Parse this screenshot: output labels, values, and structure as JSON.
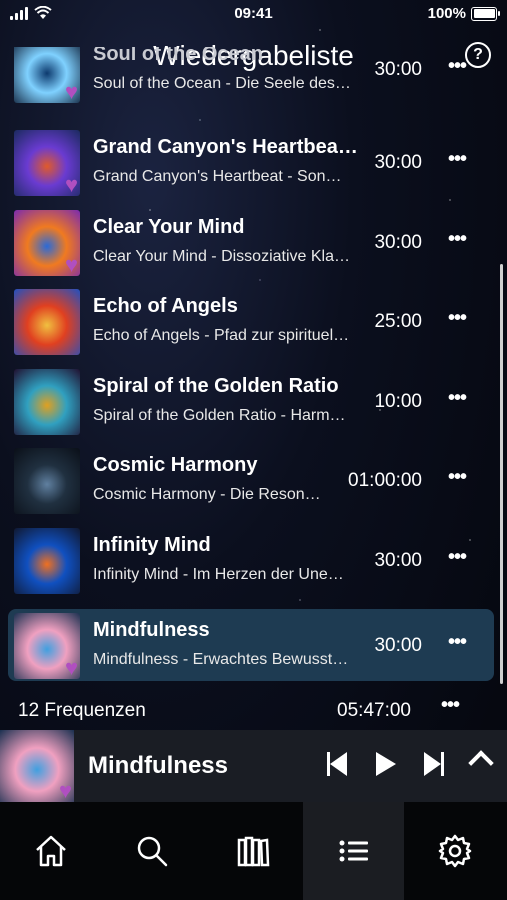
{
  "status_bar": {
    "time": "09:41",
    "battery": "100%"
  },
  "header": {
    "title": "Wiedergabeliste",
    "help_icon": "?"
  },
  "tracks": [
    {
      "title": "Soul of the Ocean",
      "subtitle": "Soul of the Ocean - Die Seele des…",
      "duration": "30:00",
      "favorite": true,
      "colors": [
        "#0d3a6e",
        "#7fd1ff",
        "#0a1830"
      ]
    },
    {
      "title": "Grand Canyon's Heartbea…",
      "subtitle": "Grand Canyon's Heartbeat - Son…",
      "duration": "30:00",
      "favorite": true,
      "colors": [
        "#e05a2a",
        "#6a3bd1",
        "#1a2a5e"
      ]
    },
    {
      "title": "Clear Your Mind",
      "subtitle": "Clear Your Mind - Dissoziative Kla…",
      "duration": "30:00",
      "favorite": true,
      "colors": [
        "#2a6ad8",
        "#f07a20",
        "#7a2ab0"
      ]
    },
    {
      "title": "Echo of Angels",
      "subtitle": "Echo of Angels - Pfad zur spirituel…",
      "duration": "25:00",
      "favorite": false,
      "colors": [
        "#f0c040",
        "#e04020",
        "#2050c0"
      ]
    },
    {
      "title": "Spiral of the Golden Ratio",
      "subtitle": "Spiral of the Golden Ratio - Harm…",
      "duration": "10:00",
      "favorite": false,
      "colors": [
        "#e0a020",
        "#30a0c0",
        "#201030"
      ]
    },
    {
      "title": "Cosmic Harmony",
      "subtitle": "Cosmic Harmony - Die Reson…",
      "duration": "01:00:00",
      "favorite": false,
      "colors": [
        "#6080a0",
        "#203040",
        "#0a0f18"
      ]
    },
    {
      "title": "Infinity Mind",
      "subtitle": "Infinity Mind - Im Herzen der Une…",
      "duration": "30:00",
      "favorite": false,
      "colors": [
        "#f07020",
        "#1050c0",
        "#101830"
      ]
    },
    {
      "title": "Mindfulness",
      "subtitle": "Mindfulness - Erwachtes Bewusst…",
      "duration": "30:00",
      "favorite": true,
      "active": true,
      "colors": [
        "#40a0e0",
        "#f0a0c0",
        "#1a3050"
      ]
    }
  ],
  "summary": {
    "count": "12 Frequenzen",
    "total": "05:47:00"
  },
  "player": {
    "title": "Mindfulness"
  },
  "tabs": [
    {
      "name": "home-icon"
    },
    {
      "name": "search-icon"
    },
    {
      "name": "library-icon"
    },
    {
      "name": "playlist-icon",
      "selected": true
    },
    {
      "name": "settings-icon"
    }
  ]
}
